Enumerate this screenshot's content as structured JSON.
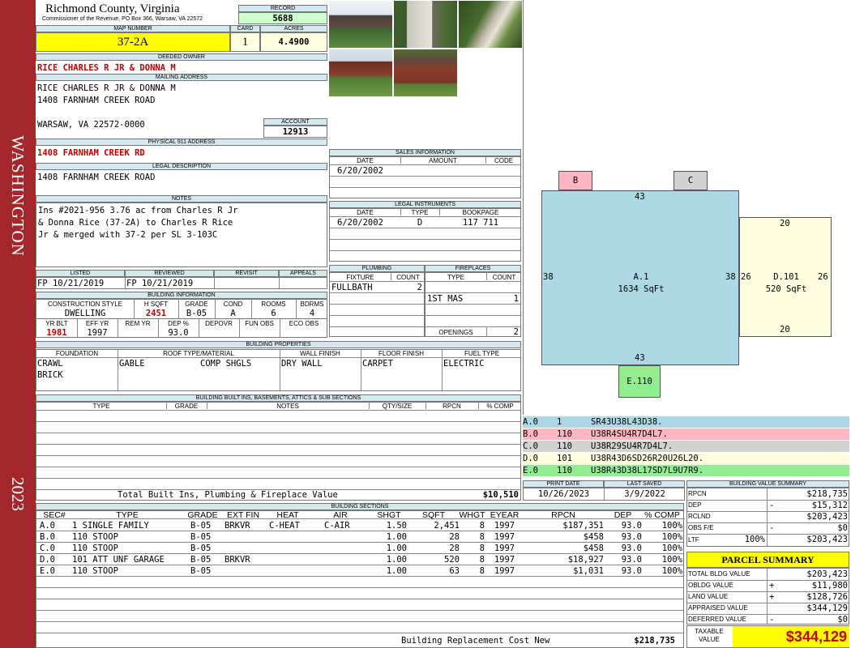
{
  "side": {
    "district": "WASHINGTON",
    "year": "2023"
  },
  "header": {
    "county": "Richmond County, Virginia",
    "address": "Commissioner of the Revenue, PO Box 366, Warsaw, VA 22572",
    "record_label": "RECORD",
    "record": "5688",
    "map_label": "MAP NUMBER",
    "map_number": "37-2A",
    "card_label": "CARD",
    "card": "1",
    "acres_label": "ACRES",
    "acres": "4.4900"
  },
  "owner": {
    "deeded_label": "DEEDED OWNER",
    "deeded": "RICE CHARLES R JR & DONNA M",
    "mailing_label": "MAILING ADDRESS",
    "mail1": "RICE CHARLES R JR & DONNA M",
    "mail2": "1408 FARNHAM CREEK ROAD",
    "mail3": "WARSAW, VA 22572-0000",
    "account_label": "ACCOUNT",
    "account": "12913",
    "physical_label": "PHYSICAL 911 ADDRESS",
    "physical": "1408 FARNHAM CREEK RD",
    "legal_label": "LEGAL DESCRIPTION",
    "legal": "1408 FARNHAM CREEK ROAD",
    "notes_label": "NOTES",
    "notes1": "Ins #2021-956 3.76 ac from Charles R Jr",
    "notes2": "& Donna Rice (37-2A) to Charles R Rice",
    "notes3": "Jr & merged with 37-2 per SL 3-103C"
  },
  "status": {
    "listed_label": "LISTED",
    "listed": "FP  10/21/2019",
    "reviewed_label": "REVIEWED",
    "reviewed": "FP  10/21/2019",
    "revisit_label": "REVISIT",
    "appeals_label": "APPEALS"
  },
  "building_info": {
    "title": "BUILDING INFORMATION",
    "h_constr": "CONSTRUCTION STYLE",
    "h_hsqft": "H SQFT",
    "h_grade": "GRADE",
    "h_cond": "COND",
    "h_rooms": "ROOMS",
    "h_bdrms": "BDRMS",
    "constr": "DWELLING",
    "hsqft": "2451",
    "grade": "B-05",
    "cond": "A",
    "rooms": "6",
    "bdrms": "4",
    "h_yrblt": "YR BLT",
    "h_effyr": "EFF YR",
    "h_remyr": "REM YR",
    "h_dep": "DEP %",
    "h_depovr": "DEPOVR",
    "h_funobs": "FUN OBS",
    "h_ecoobs": "ECO OBS",
    "yrblt": "1981",
    "effyr": "1997",
    "dep": "93.0"
  },
  "sales": {
    "title": "SALES INFORMATION",
    "h_date": "DATE",
    "h_amount": "AMOUNT",
    "h_code": "CODE",
    "date": "6/20/2002"
  },
  "legal_inst": {
    "title": "LEGAL INSTRUMENTS",
    "h_date": "DATE",
    "h_type": "TYPE",
    "h_book": "BOOKPAGE",
    "date": "6/20/2002",
    "type": "D",
    "book": "117 711"
  },
  "plumbing": {
    "title": "PLUMBING",
    "h_fixture": "FIXTURE",
    "h_count": "COUNT",
    "fixture": "FULLBATH",
    "count": "2"
  },
  "fireplaces": {
    "title": "FIREPLACES",
    "h_type": "TYPE",
    "h_count": "COUNT",
    "type": "1ST MAS",
    "count": "1",
    "openings_label": "OPENINGS",
    "openings": "2"
  },
  "properties": {
    "title": "BUILDING PROPERTIES",
    "h_found": "FOUNDATION",
    "h_roof": "ROOF TYPE/MATERIAL",
    "h_wall": "WALL FINISH",
    "h_floor": "FLOOR FINISH",
    "h_fuel": "FUEL TYPE",
    "found1": "CRAWL",
    "found2": "BRICK",
    "roof_type": "GABLE",
    "roof_mat": "COMP SHGLS",
    "wall": "DRY WALL",
    "floor": "CARPET",
    "fuel": "ELECTRIC"
  },
  "builtins": {
    "title": "BUILDING BUILT INS, BASEMENTS, ATTICS & SUB SECTIONS",
    "h_type": "TYPE",
    "h_grade": "GRADE",
    "h_notes": "NOTES",
    "h_qty": "QTY/SIZE",
    "h_rpcn": "RPCN",
    "h_comp": "% COMP",
    "total_label": "Total Built Ins, Plumbing & Fireplace Value",
    "total": "$10,510"
  },
  "sketch": {
    "B": "B",
    "C": "C",
    "A_label": "A.1",
    "A_area": "1634 SqFt",
    "D_label": "D.101",
    "D_area": "520 SqFt",
    "E_label": "E.110",
    "dA_top": "43",
    "dA_bottom": "43",
    "dA_left": "38",
    "dA_right": "38",
    "dD_top": "20",
    "dD_bottom": "20",
    "dD_left": "26",
    "dD_right": "26"
  },
  "legend": [
    {
      "code": "A.0",
      "num": "1",
      "desc": "SR43U38L43D38.",
      "color": "#add8e6"
    },
    {
      "code": "B.0",
      "num": "110",
      "desc": "U38R4SU4R7D4L7.",
      "color": "#ffb6c1"
    },
    {
      "code": "C.0",
      "num": "110",
      "desc": "U38R29SU4R7D4L7.",
      "color": "#d3d3d3"
    },
    {
      "code": "D.0",
      "num": "101",
      "desc": "U38R43D6SD26R20U26L20.",
      "color": "#fffde0"
    },
    {
      "code": "E.0",
      "num": "110",
      "desc": "U38R43D38L17SD7L9U7R9.",
      "color": "#90ee90"
    }
  ],
  "dates": {
    "print_label": "PRINT DATE",
    "print": "10/26/2023",
    "saved_label": "LAST SAVED",
    "saved": "3/9/2022"
  },
  "sections": {
    "title": "BUILDING SECTIONS",
    "headers": [
      "SEC#",
      "TYPE",
      "GRADE",
      "EXT FIN",
      "HEAT",
      "AIR",
      "SHGT",
      "SQFT",
      "WHGT",
      "EYEAR",
      "RPCN",
      "DEP",
      "% COMP"
    ],
    "rows": [
      {
        "sec": "A.0",
        "type": "1 SINGLE FAMILY",
        "grade": "B-05",
        "ext": "BRKVR",
        "heat": "C-HEAT",
        "air": "C-AIR",
        "shgt": "1.50",
        "sqft": "2,451",
        "whgt": "8",
        "eyear": "1997",
        "rpcn": "$187,351",
        "dep": "93.0",
        "comp": "100%"
      },
      {
        "sec": "B.0",
        "type": "110 STOOP",
        "grade": "B-05",
        "ext": "",
        "heat": "",
        "air": "",
        "shgt": "1.00",
        "sqft": "28",
        "whgt": "8",
        "eyear": "1997",
        "rpcn": "$458",
        "dep": "93.0",
        "comp": "100%"
      },
      {
        "sec": "C.0",
        "type": "110 STOOP",
        "grade": "B-05",
        "ext": "",
        "heat": "",
        "air": "",
        "shgt": "1.00",
        "sqft": "28",
        "whgt": "8",
        "eyear": "1997",
        "rpcn": "$458",
        "dep": "93.0",
        "comp": "100%"
      },
      {
        "sec": "D.0",
        "type": "101 ATT UNF GARAGE",
        "grade": "B-05",
        "ext": "BRKVR",
        "heat": "",
        "air": "",
        "shgt": "1.00",
        "sqft": "520",
        "whgt": "8",
        "eyear": "1997",
        "rpcn": "$18,927",
        "dep": "93.0",
        "comp": "100%"
      },
      {
        "sec": "E.0",
        "type": "110 STOOP",
        "grade": "B-05",
        "ext": "",
        "heat": "",
        "air": "",
        "shgt": "1.00",
        "sqft": "63",
        "whgt": "8",
        "eyear": "1997",
        "rpcn": "$1,031",
        "dep": "93.0",
        "comp": "100%"
      }
    ],
    "replacement_label": "Building Replacement Cost New",
    "replacement": "$218,735"
  },
  "bv_summary": {
    "title": "BUILDING VALUE SUMMARY",
    "rpcn_label": "RPCN",
    "rpcn": "$218,735",
    "dep_label": "DEP",
    "dep_sign": "-",
    "dep": "$15,312",
    "rclnd_label": "RCLND",
    "rclnd": "$203,423",
    "obs_label": "OBS F/E",
    "obs_sign": "-",
    "obs": "$0",
    "ltf_label": "LTF",
    "ltf_pct": "100%",
    "ltf": "$203,423"
  },
  "parcel": {
    "title": "PARCEL SUMMARY",
    "tbv_label": "TOTAL BLDG VALUE",
    "tbv": "$203,423",
    "obldg_label": "OBLDG VALUE",
    "obldg_sign": "+",
    "obldg": "$11,980",
    "land_label": "LAND VALUE",
    "land_sign": "+",
    "land": "$128,726",
    "appr_label": "APPRAISED VALUE",
    "appr": "$344,129",
    "def_label": "DEFERRED VALUE",
    "def_sign": "-",
    "def": "$0",
    "taxable_label": "TAXABLE",
    "taxable_label2": "VALUE",
    "taxable": "$344,129"
  }
}
